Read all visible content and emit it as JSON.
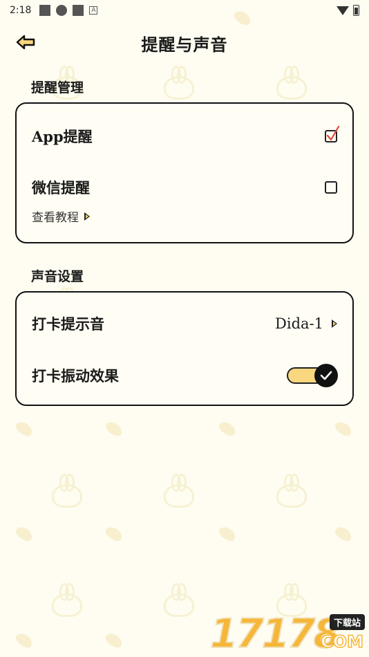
{
  "status_bar": {
    "time": "2:18"
  },
  "header": {
    "title": "提醒与声音"
  },
  "reminder_section": {
    "title": "提醒管理",
    "app_reminder": {
      "label": "App提醒",
      "checked": true
    },
    "wechat_reminder": {
      "label": "微信提醒",
      "checked": false
    },
    "tutorial_link": "查看教程"
  },
  "sound_section": {
    "title": "声音设置",
    "checkin_sound": {
      "label": "打卡提示音",
      "value": "Dida-1"
    },
    "checkin_vibration": {
      "label": "打卡振动效果",
      "enabled": true
    }
  },
  "watermark": {
    "number": "17178",
    "badge": "下载站",
    "domain": "COM"
  },
  "colors": {
    "background": "#fffdf2",
    "accent": "#f8d77f",
    "border": "#111111",
    "check": "#e0443a"
  }
}
